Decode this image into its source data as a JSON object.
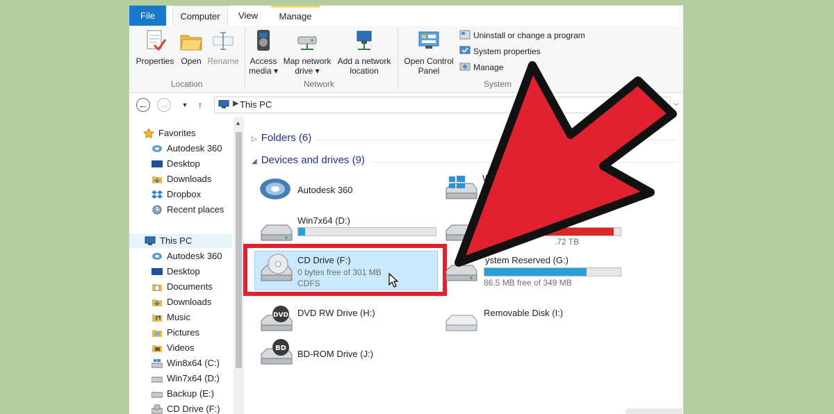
{
  "tabs": {
    "file": "File",
    "computer": "Computer",
    "view": "View",
    "manage": "Manage"
  },
  "ribbon": {
    "location": {
      "properties": "Properties",
      "open": "Open",
      "rename": "Rename",
      "label": "Location"
    },
    "network": {
      "access_media_1": "Access",
      "access_media_2": "media ▾",
      "map_drive_1": "Map network",
      "map_drive_2": "drive ▾",
      "add_location_1": "Add a network",
      "add_location_2": "location",
      "label": "Network"
    },
    "system": {
      "control_panel_1": "Open Control",
      "control_panel_2": "Panel",
      "uninstall": "Uninstall or change a program",
      "system_properties": "System properties",
      "manage": "Manage",
      "label": "System"
    }
  },
  "address": {
    "path": "This PC"
  },
  "nav": {
    "favorites": "Favorites",
    "fav_items": [
      "Autodesk 360",
      "Desktop",
      "Downloads",
      "Dropbox",
      "Recent places"
    ],
    "this_pc": "This PC",
    "pc_items": [
      "Autodesk 360",
      "Desktop",
      "Documents",
      "Downloads",
      "Music",
      "Pictures",
      "Videos",
      "Win8x64 (C:)",
      "Win7x64 (D:)",
      "Backup (E:)",
      "CD Drive (F:)"
    ]
  },
  "content": {
    "folders_header": "Folders (6)",
    "devices_header": "Devices and drives (9)",
    "devices": {
      "autodesk": {
        "name": "Autodesk 360"
      },
      "win7": {
        "name": "Win7x64 (D:)",
        "usage_fraction": 0.05
      },
      "cd": {
        "name": "CD Drive (F:)",
        "free": "0 bytes free of 301 MB",
        "fs": "CDFS"
      },
      "dvd": {
        "name": "DVD RW Drive (H:)",
        "badge": "DVD"
      },
      "bd": {
        "name": "BD-ROM Drive (J:)",
        "badge": "BD"
      },
      "win8": {
        "name_partial": "Wi"
      },
      "backup": {
        "free_partial": ".72 TB",
        "usage_fraction": 0.95
      },
      "sysres": {
        "name_partial": "ystem Reserved (G:)",
        "free": "86.5 MB free of 349 MB",
        "usage_fraction": 0.75
      },
      "removable": {
        "name": "Removable Disk (I:)"
      }
    }
  },
  "colors": {
    "accent": "#1979ca",
    "highlight_red": "#e0212f",
    "selection": "#cce8ff",
    "background": "#b5cfa0"
  }
}
